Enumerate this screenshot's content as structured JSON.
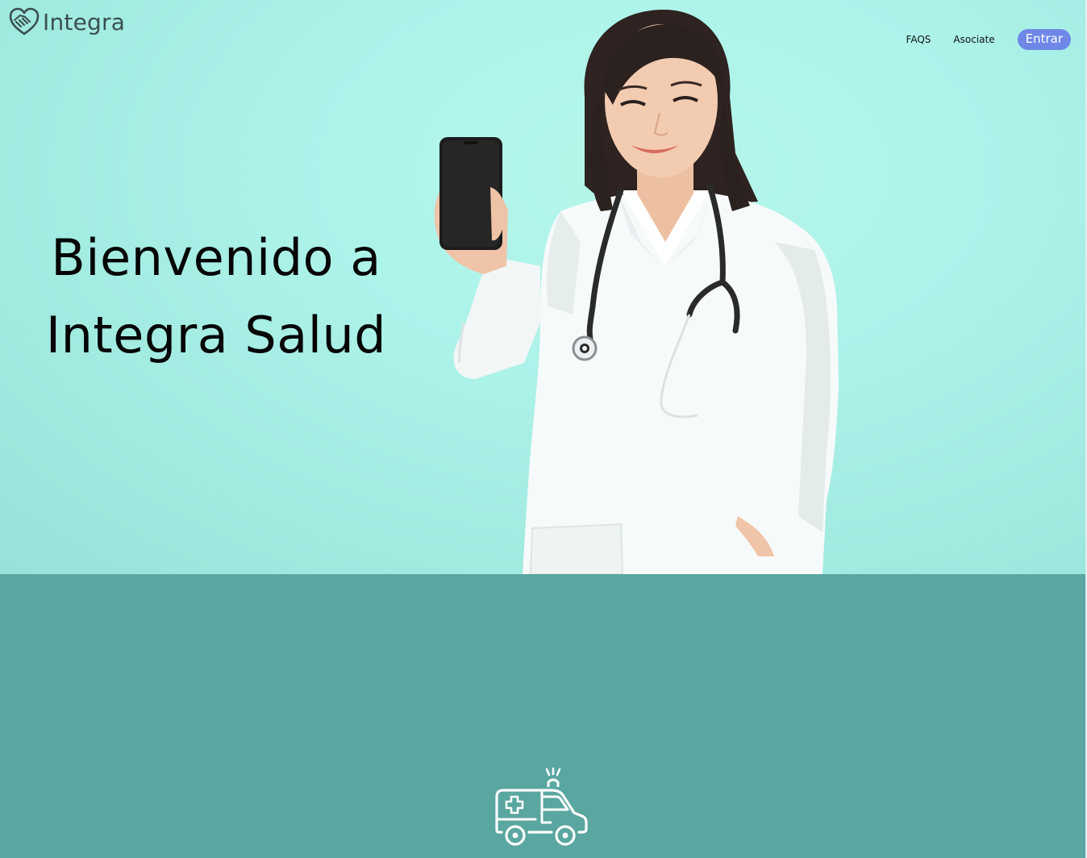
{
  "brand": {
    "name": "Integra",
    "logo_icon": "handshake-heart-icon",
    "color": "#3b4f4c"
  },
  "nav": {
    "faqs_label": "FAQS",
    "asociate_label": "Asociate",
    "entrar_label": "Entrar",
    "cta_color": "#6f88e8"
  },
  "hero": {
    "title_line1": "Bienvenido a",
    "title_line2": "Integra Salud",
    "background_color": "#adf3ea",
    "image": "doctor-holding-phone"
  },
  "services": {
    "background_color": "#5aa6a0",
    "icon": "ambulance-icon"
  }
}
